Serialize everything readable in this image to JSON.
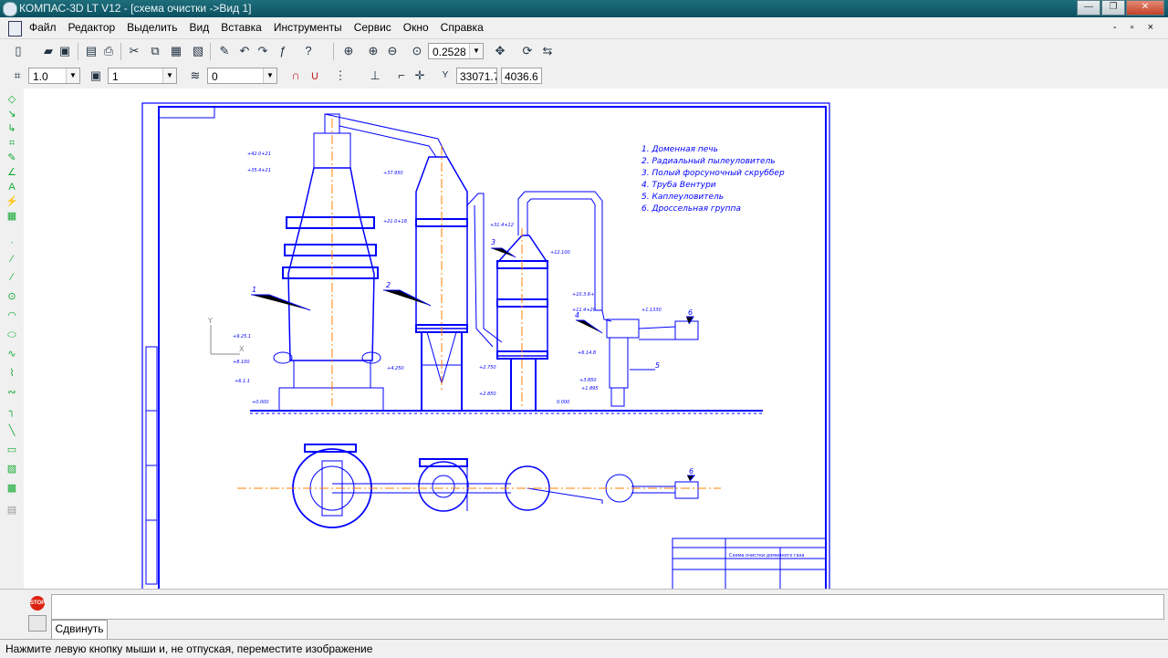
{
  "window": {
    "title": "КОМПАС-3D LT V12 - [схема очистки ->Вид 1]",
    "controls": [
      "—",
      "❐",
      "✕"
    ]
  },
  "menu": {
    "items": [
      "Файл",
      "Редактор",
      "Выделить",
      "Вид",
      "Вставка",
      "Инструменты",
      "Сервис",
      "Окно",
      "Справка"
    ],
    "mdi_controls": "- ▫ ×"
  },
  "toolbar1": {
    "zoom_value": "0.2528"
  },
  "toolbar2": {
    "line_scale": "1.0",
    "layer": "1",
    "style": "0",
    "coord_label": "Y",
    "coord_x": "33071.7",
    "coord_y": "4036.6"
  },
  "drawing": {
    "legend": [
      "1. Доменная печь",
      "2. Радиальный пылеуловитель",
      "3. Полый форсуночный скруббер",
      "4. Труба Вентури",
      "5. Каплеуловитель",
      "6. Дроссельная группа"
    ],
    "callouts": [
      "1",
      "2",
      "3",
      "4",
      "5",
      "6",
      "6"
    ],
    "elevations": [
      "+42.0+21",
      "+35.4+21",
      "+37.950",
      "+21.0+18",
      "+31.4+12",
      "+12.100",
      "+9.25.1",
      "+8.100",
      "+6.1.1",
      "+4.250",
      "+2.750",
      "+2.850",
      "+0.000",
      "0.000",
      "+10.3.6+",
      "+11.4+20",
      "+1.1330",
      "+6.14.8",
      "+3.850",
      "+1.895"
    ],
    "title_block": "Схема очистки доменного газа",
    "axis_y": "Y",
    "axis_x": "X"
  },
  "command_panel": {
    "tab_label": "Сдвинуть",
    "stop_label": "STOP"
  },
  "status": {
    "text": "Нажмите левую кнопку мыши и, не отпуская, переместите изображение"
  },
  "colors": {
    "drawing": "#0000ff",
    "axis": "#ff8000",
    "titlebar": "#0b5161"
  }
}
